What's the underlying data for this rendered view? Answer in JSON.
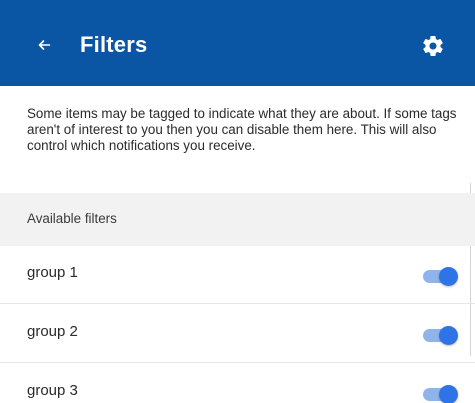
{
  "appbar": {
    "title": "Filters",
    "back_icon": "arrow-left-icon",
    "settings_icon": "gear-icon",
    "background_color": "#0b55a5"
  },
  "intro": {
    "text": "Some items may be tagged to indicate what they are about. If some tags aren't of interest to you then you can disable them here. This will also control which notifications you receive."
  },
  "section": {
    "title": "Available filters"
  },
  "filters": [
    {
      "label": "group 1",
      "enabled": true
    },
    {
      "label": "group 2",
      "enabled": true
    },
    {
      "label": "group 3",
      "enabled": true
    }
  ],
  "colors": {
    "toggle_on_thumb": "#2f74e6",
    "toggle_on_track": "#8fb4ec"
  }
}
